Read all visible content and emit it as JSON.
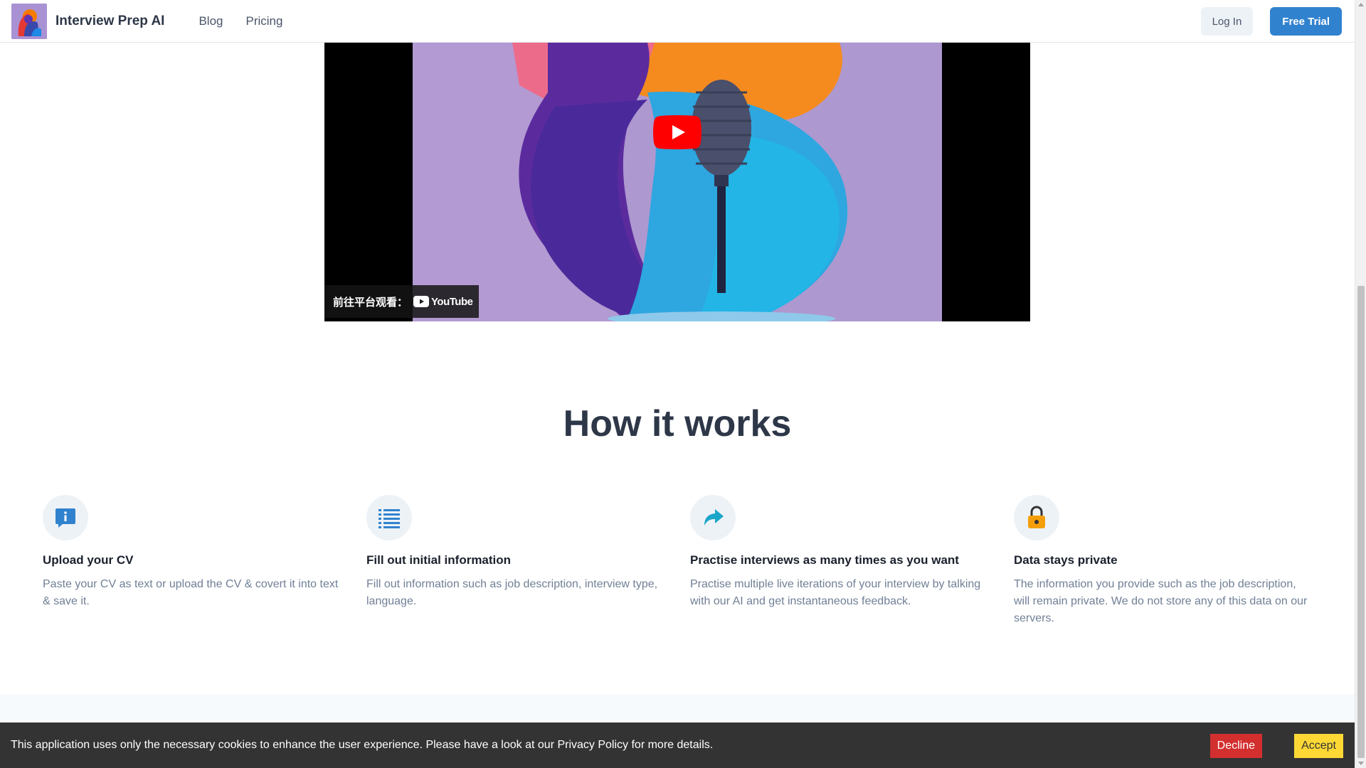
{
  "header": {
    "brand": "Interview Prep AI",
    "nav": [
      {
        "label": "Blog"
      },
      {
        "label": "Pricing"
      }
    ],
    "login_label": "Log In",
    "trial_label": "Free Trial"
  },
  "video": {
    "watch_on_label": "前往平台观看：",
    "platform_label": "YouTube"
  },
  "how_it_works": {
    "title": "How it works",
    "features": [
      {
        "icon": "info-chat-icon",
        "title": "Upload your CV",
        "text": "Paste your CV as text or upload the CV & covert it into text & save it."
      },
      {
        "icon": "list-icon",
        "title": "Fill out initial information",
        "text": "Fill out information such as job description, interview type, language."
      },
      {
        "icon": "forward-arrow-icon",
        "title": "Practise interviews as many times as you want",
        "text": "Practise multiple live iterations of your interview by talking with our AI and get instantaneous feedback."
      },
      {
        "icon": "lock-icon",
        "title": "Data stays private",
        "text": "The information you provide such as the job description, will remain private. We do not store any of this data on our servers."
      }
    ]
  },
  "cookie": {
    "text": "This application uses only the necessary cookies to enhance the user experience. Please have a look at our Privacy Policy for more details.",
    "decline_label": "Decline",
    "accept_label": "Accept"
  },
  "colors": {
    "primary": "#3182ce",
    "decline": "#d32f2f",
    "accept": "#fdd835",
    "cookie_bg": "#333333"
  }
}
